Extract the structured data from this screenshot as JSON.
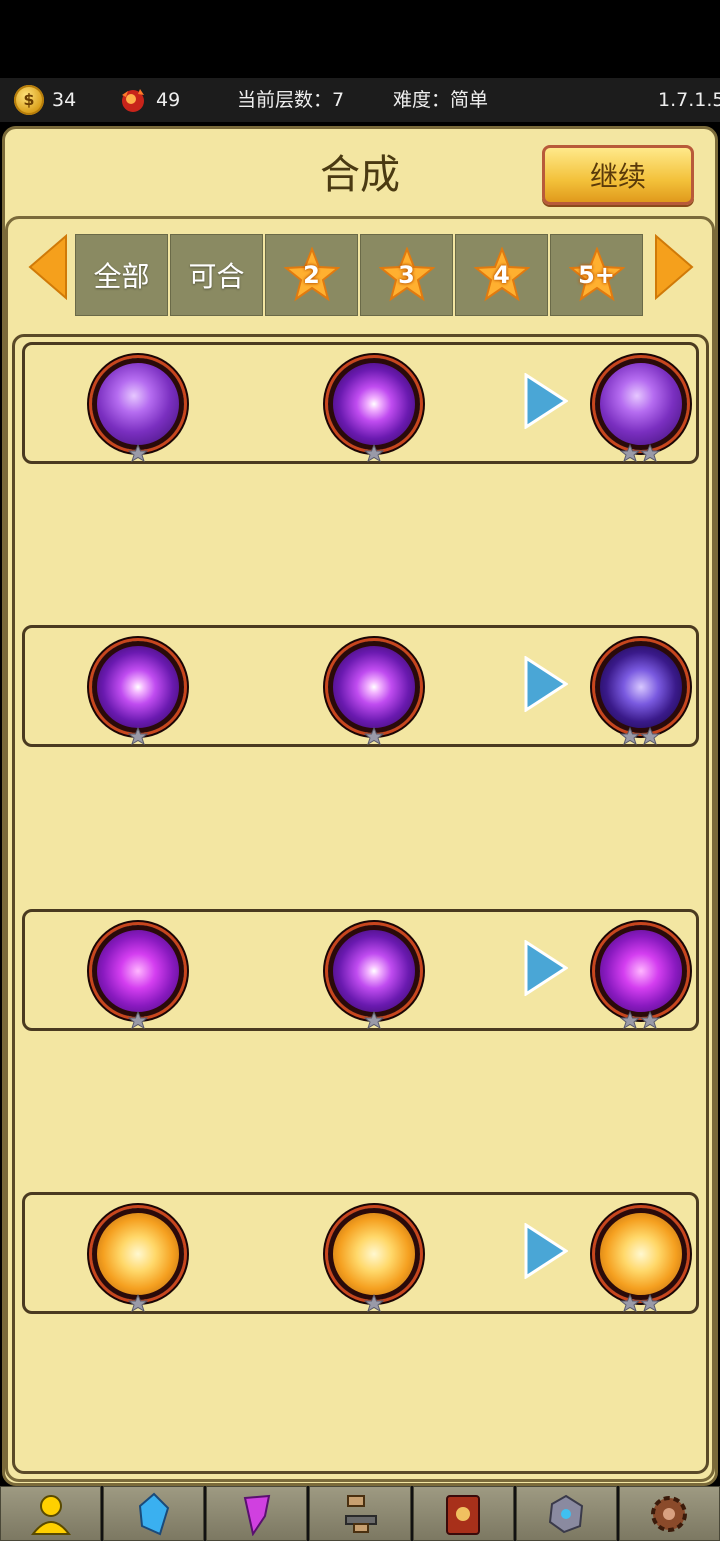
{
  "topbar": {
    "coins": "34",
    "gems": "49",
    "floor": "当前层数：7",
    "difficulty": "难度：简单",
    "version": "1.7.1.5"
  },
  "header": {
    "title": "合成",
    "continue_label": "继续"
  },
  "tabs": {
    "all": "全部",
    "combinable": "可合",
    "star2": "2",
    "star3": "3",
    "star4": "4",
    "star5": "5+"
  },
  "recipes": [
    {
      "input1": "lightning-orb",
      "input2": "purple-burst-orb",
      "output": "lightning-orb",
      "output_stars": 2
    },
    {
      "input1": "purple-burst-orb",
      "input2": "purple-burst-orb",
      "output": "purple-cell-orb",
      "output_stars": 2
    },
    {
      "input1": "purple-vortex-orb",
      "input2": "purple-burst-orb",
      "output": "purple-vortex-orb",
      "output_stars": 2
    },
    {
      "input1": "fire-burst-orb",
      "input2": "fire-burst-orb",
      "output": "fire-burst-orb",
      "output_stars": 2
    }
  ],
  "bottom_nav": [
    "hero-icon",
    "crystal-icon",
    "purple-gem-icon",
    "anvil-icon",
    "spellbook-icon",
    "rune-stone-icon",
    "gear-icon"
  ],
  "colors": {
    "panel": "#f3e6a2",
    "accent": "#f5a01c"
  }
}
